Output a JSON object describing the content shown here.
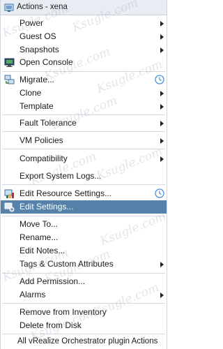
{
  "header": {
    "title": "Actions - xena"
  },
  "watermark": "Ksugle.com",
  "menu": {
    "power": "Power",
    "guest_os": "Guest OS",
    "snapshots": "Snapshots",
    "open_console": "Open Console",
    "migrate": "Migrate...",
    "clone": "Clone",
    "template": "Template",
    "fault_tolerance": "Fault Tolerance",
    "vm_policies": "VM Policies",
    "compatibility": "Compatibility",
    "export_system_logs": "Export System Logs...",
    "edit_resource_settings": "Edit Resource Settings...",
    "edit_settings": "Edit Settings...",
    "move_to": "Move To...",
    "rename": "Rename...",
    "edit_notes": "Edit Notes...",
    "tags_custom_attributes": "Tags & Custom Attributes",
    "add_permission": "Add Permission...",
    "alarms": "Alarms",
    "remove_from_inventory": "Remove from Inventory",
    "delete_from_disk": "Delete from Disk",
    "vro_actions": "All vRealize Orchestrator plugin Actions"
  },
  "colors": {
    "selected": "#5682a9",
    "header_bg": "#e7edf3",
    "clock": "#4a90d9"
  },
  "icons": [
    "vm-actions-icon",
    "console-icon",
    "migrate-icon",
    "resource-settings-icon",
    "edit-settings-icon",
    "clock-icon",
    "submenu-arrow-icon"
  ]
}
